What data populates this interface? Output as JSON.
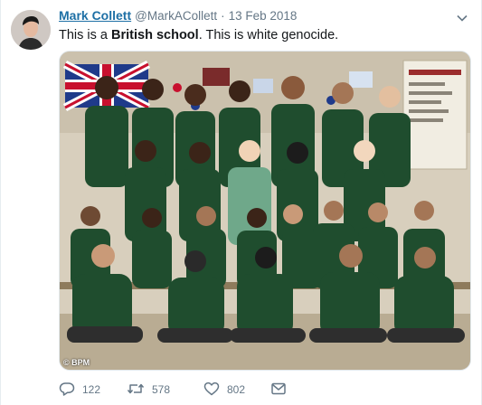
{
  "tweet": {
    "author_name": "Mark Collett",
    "handle": "@MarkACollett",
    "separator": "·",
    "date": "13 Feb 2018",
    "text_before": "This is a ",
    "text_bold": "British school",
    "text_after": ". This is white genocide.",
    "photo_credit": "© BPM"
  },
  "actions": {
    "reply_count": "122",
    "retweet_count": "578",
    "like_count": "802"
  },
  "icons": {
    "reply": "reply-icon",
    "retweet": "retweet-icon",
    "like": "heart-icon",
    "message": "envelope-icon",
    "menu": "chevron-down-icon"
  },
  "colors": {
    "name_link": "#1d6fa5",
    "secondary_text": "#657786",
    "uniform_green": "#1f4d2e"
  }
}
